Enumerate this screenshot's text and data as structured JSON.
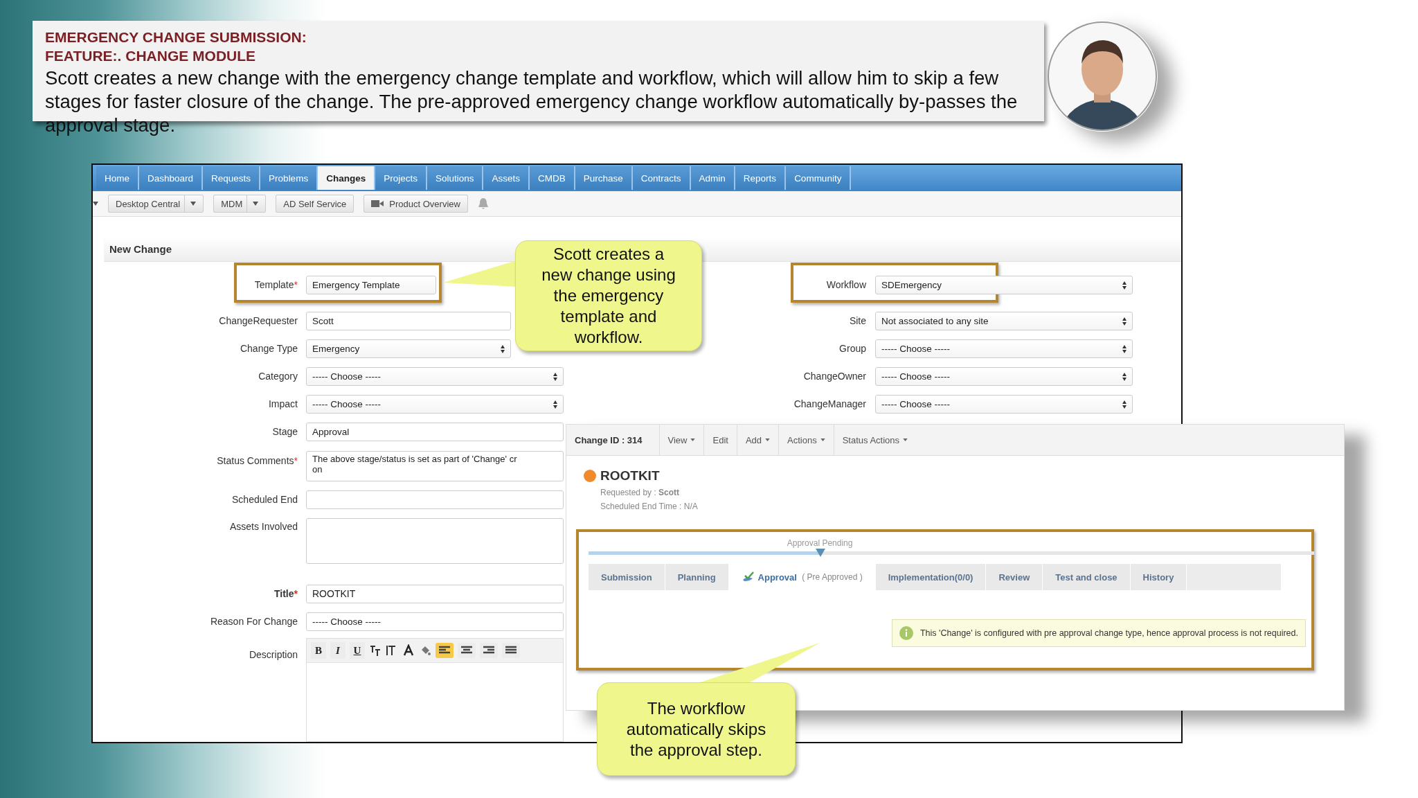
{
  "slide": {
    "heading": [
      "EMERGENCY CHANGE SUBMISSION:",
      "FEATURE:. CHANGE MODULE"
    ],
    "body": "Scott creates a new change with the emergency change template and workflow, which will allow him to skip a few stages for faster closure of the change. The pre-approved emergency change workflow automatically by-passes the approval stage.",
    "avatar": {
      "kind": "picture"
    }
  },
  "app": {
    "nav_tabs": [
      {
        "label": "Home",
        "selected": false
      },
      {
        "label": "Dashboard",
        "selected": false
      },
      {
        "label": "Requests",
        "selected": false
      },
      {
        "label": "Problems",
        "selected": false
      },
      {
        "label": "Changes",
        "selected": true
      },
      {
        "label": "Projects",
        "selected": false
      },
      {
        "label": "Solutions",
        "selected": false
      },
      {
        "label": "Assets",
        "selected": false
      },
      {
        "label": "CMDB",
        "selected": false
      },
      {
        "label": "Purchase",
        "selected": false
      },
      {
        "label": "Contracts",
        "selected": false
      },
      {
        "label": "Admin",
        "selected": false
      },
      {
        "label": "Reports",
        "selected": false
      },
      {
        "label": "Community",
        "selected": false
      }
    ],
    "toolbar": [
      {
        "kind": "caret"
      },
      {
        "kind": "dropdown",
        "label": "Desktop Central"
      },
      {
        "kind": "dropdown",
        "label": "MDM"
      },
      {
        "kind": "button",
        "label": "AD Self Service"
      },
      {
        "kind": "video",
        "label": "Product Overview"
      },
      {
        "kind": "bell"
      }
    ],
    "panel_title": "New Change",
    "left_fields": [
      {
        "label": "Template",
        "mark": "*",
        "kind": "short",
        "value": "Emergency Template",
        "highlighted": true
      },
      {
        "label": "ChangeRequester",
        "kind": "text",
        "value": "Scott",
        "highlighted": false
      },
      {
        "label": "Change Type",
        "kind": "select",
        "value": "Emergency",
        "highlighted": false
      },
      {
        "label": "Category",
        "kind": "select",
        "value": "----- Choose -----",
        "highlighted": false
      },
      {
        "label": "Impact",
        "kind": "select",
        "value": "----- Choose -----",
        "highlighted": false
      },
      {
        "label": "Stage",
        "kind": "text",
        "value": "Approval",
        "highlighted": false
      },
      {
        "label": "Status Comments",
        "mark": "*",
        "kind": "textarea",
        "value": "The above stage/status is set as part of 'Change' cr\non",
        "highlighted": false
      },
      {
        "label": "Scheduled End",
        "kind": "text",
        "highlighted": false
      },
      {
        "label": "Assets Involved",
        "kind": "area",
        "highlighted": false
      },
      {
        "label": "Title",
        "mark": "*",
        "kind": "title",
        "value": "ROOTKIT",
        "highlighted": false
      },
      {
        "label": "Reason For Change",
        "kind": "text",
        "value": "----- Choose -----",
        "highlighted": false
      }
    ],
    "right_fields": [
      {
        "label": "Workflow",
        "kind": "select",
        "value": "SDEmergency",
        "highlighted": true
      },
      {
        "label": "Site",
        "kind": "select",
        "value": "Not associated to any site",
        "highlighted": false
      },
      {
        "label": "Group",
        "kind": "select",
        "value": "----- Choose -----",
        "highlighted": false
      },
      {
        "label": "ChangeOwner",
        "kind": "select",
        "value": "----- Choose -----",
        "highlighted": false
      },
      {
        "label": "ChangeManager",
        "kind": "select",
        "value": "----- Choose -----",
        "highlighted": false
      }
    ],
    "editor": {
      "label": "Description",
      "format_buttons": [
        "B",
        "I",
        "U"
      ],
      "alignment": [
        {
          "selected": true
        },
        {
          "selected": false
        },
        {
          "selected": false
        },
        {
          "selected": false
        }
      ]
    },
    "details": {
      "toolbar": [
        {
          "kind": "id",
          "label": "Change ID : 314"
        },
        {
          "kind": "menu",
          "label": "View"
        },
        {
          "kind": "action",
          "label": "Edit"
        },
        {
          "kind": "menu",
          "label": "Add"
        },
        {
          "kind": "menu",
          "label": "Actions"
        },
        {
          "kind": "menu",
          "label": "Status Actions"
        }
      ],
      "title": "ROOTKIT",
      "requested_by": "Requested by : **Scott**",
      "scheduled_end": "Scheduled End Time : N/A",
      "stages": {
        "highlighted": true,
        "status": "Approval Pending",
        "level": 0.32
      },
      "tabs": [
        {
          "label": "Submission",
          "selected": false
        },
        {
          "label": "Planning",
          "selected": false
        },
        {
          "label": "Approval",
          "note": "( Pre Approved )",
          "selected": true
        },
        {
          "label": "Implementation(0/0)",
          "selected": false
        },
        {
          "label": "Review",
          "selected": false
        },
        {
          "label": "Test and close",
          "selected": false
        },
        {
          "label": "History",
          "selected": false
        }
      ],
      "message": "This 'Change' is configured with pre approval change type, hence approval process is not required."
    }
  },
  "callouts": [
    {
      "text": "Scott creates a new change using the emergency template and workflow."
    },
    {
      "text": "The workflow automatically skips the approval step."
    }
  ]
}
